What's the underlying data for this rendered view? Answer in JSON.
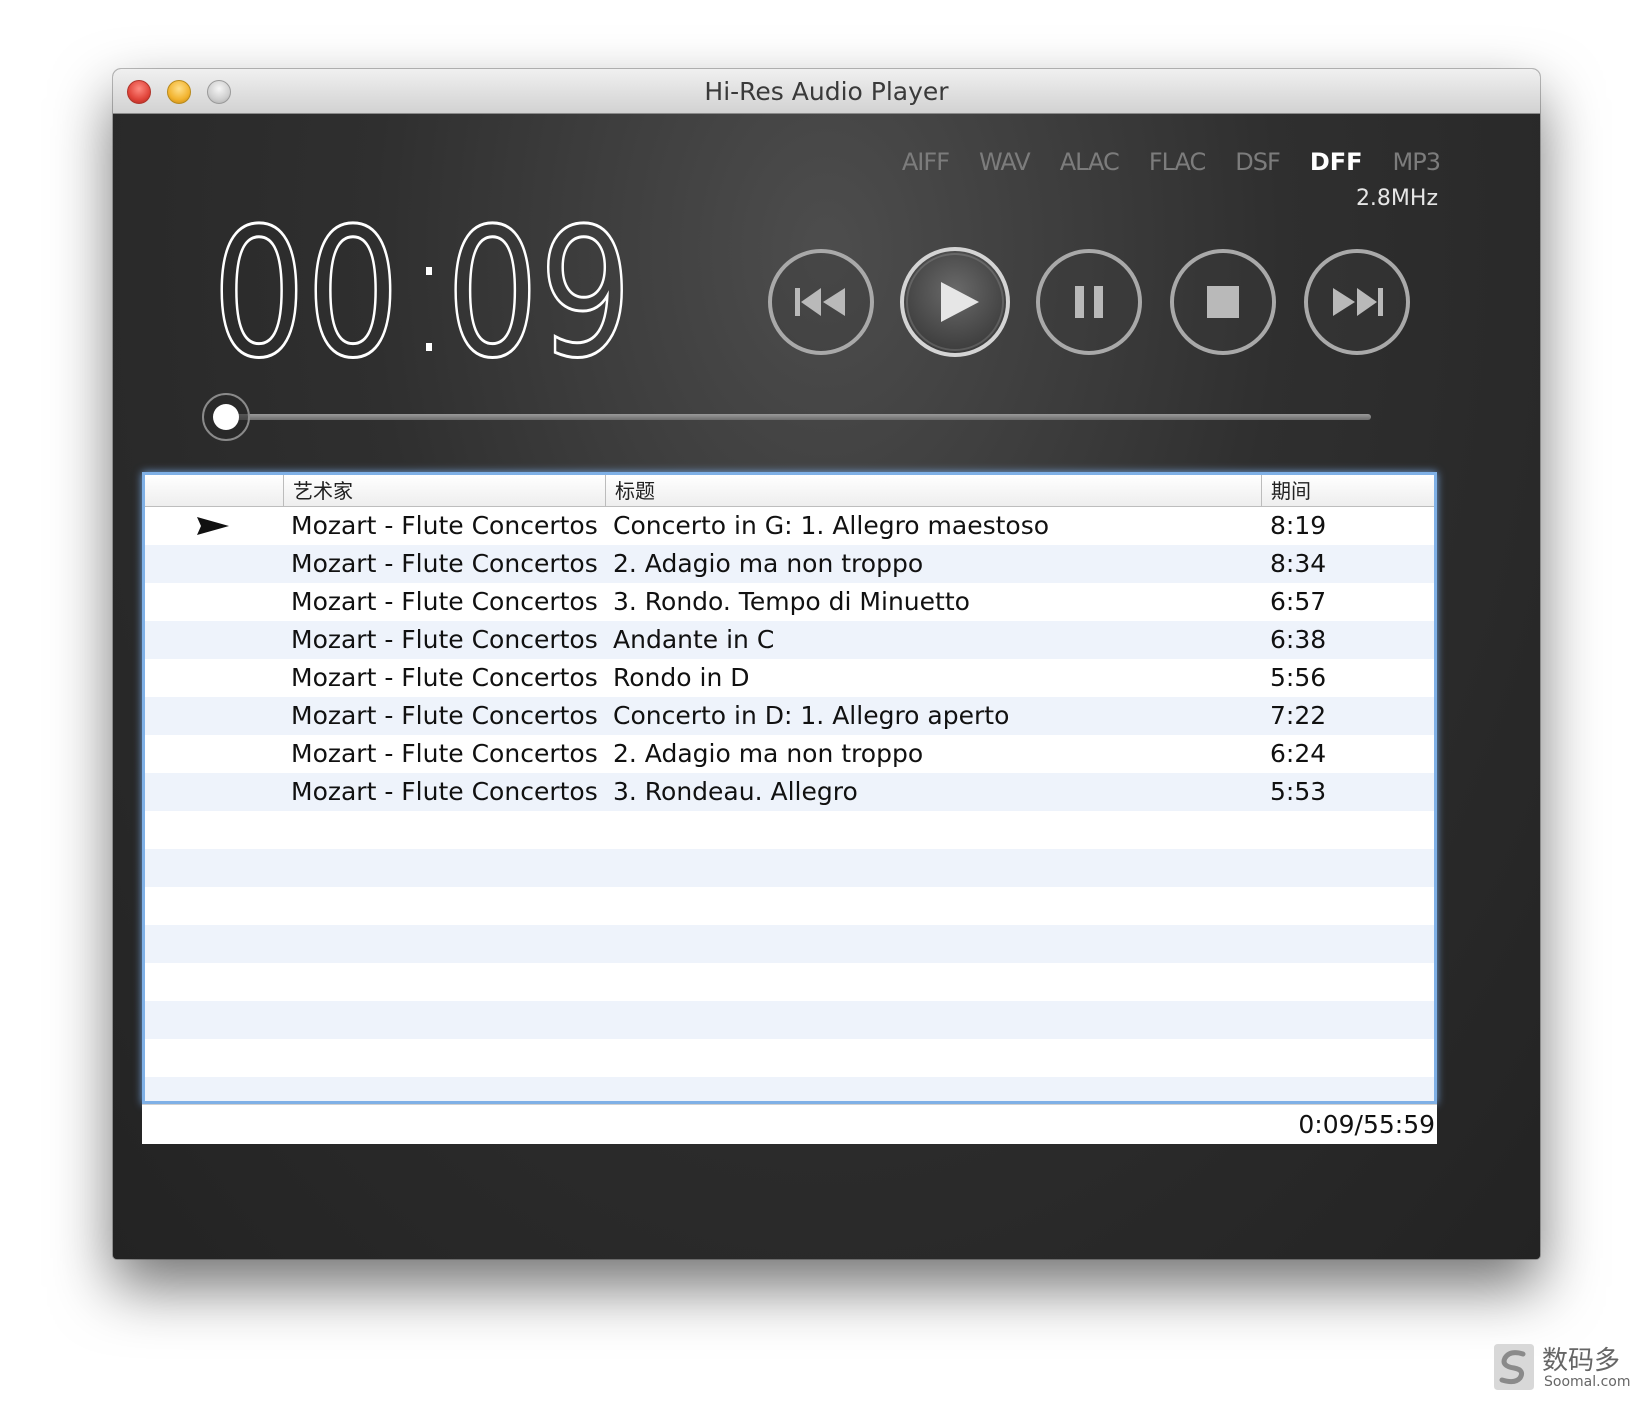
{
  "window": {
    "title": "Hi-Res Audio Player"
  },
  "formats": [
    {
      "label": "AIFF",
      "active": false
    },
    {
      "label": "WAV",
      "active": false
    },
    {
      "label": "ALAC",
      "active": false
    },
    {
      "label": "FLAC",
      "active": false
    },
    {
      "label": "DSF",
      "active": false
    },
    {
      "label": "DFF",
      "active": true
    },
    {
      "label": "MP3",
      "active": false
    }
  ],
  "sample_rate": "2.8MHz",
  "timer": {
    "minutes": "00",
    "separator": ":",
    "seconds": "09"
  },
  "controls": {
    "previous": "previous-icon",
    "play": "play-icon",
    "pause": "pause-icon",
    "stop": "stop-icon",
    "next": "next-icon"
  },
  "progress": {
    "fraction": 0.003
  },
  "playlist": {
    "columns": {
      "artist": "艺术家",
      "title": "标题",
      "duration": "期间"
    },
    "now_playing_index": 0,
    "tracks": [
      {
        "artist": "Mozart - Flute Concertos",
        "title": "Concerto in G: 1. Allegro maestoso",
        "duration": "8:19"
      },
      {
        "artist": "Mozart - Flute Concertos",
        "title": "2. Adagio ma non troppo",
        "duration": "8:34"
      },
      {
        "artist": "Mozart - Flute Concertos",
        "title": "3. Rondo. Tempo di Minuetto",
        "duration": "6:57"
      },
      {
        "artist": "Mozart - Flute Concertos",
        "title": "Andante in C",
        "duration": "6:38"
      },
      {
        "artist": "Mozart - Flute Concertos",
        "title": "Rondo in D",
        "duration": "5:56"
      },
      {
        "artist": "Mozart - Flute Concertos",
        "title": "Concerto in D: 1. Allegro aperto",
        "duration": "7:22"
      },
      {
        "artist": "Mozart - Flute Concertos",
        "title": "2. Adagio ma non troppo",
        "duration": "6:24"
      },
      {
        "artist": "Mozart - Flute Concertos",
        "title": "3. Rondeau. Allegro",
        "duration": "5:53"
      }
    ],
    "empty_rows": 8
  },
  "status": {
    "total_time": "0:09/55:59"
  },
  "watermark": {
    "cn": "数码多",
    "en": "Soomal.com"
  }
}
